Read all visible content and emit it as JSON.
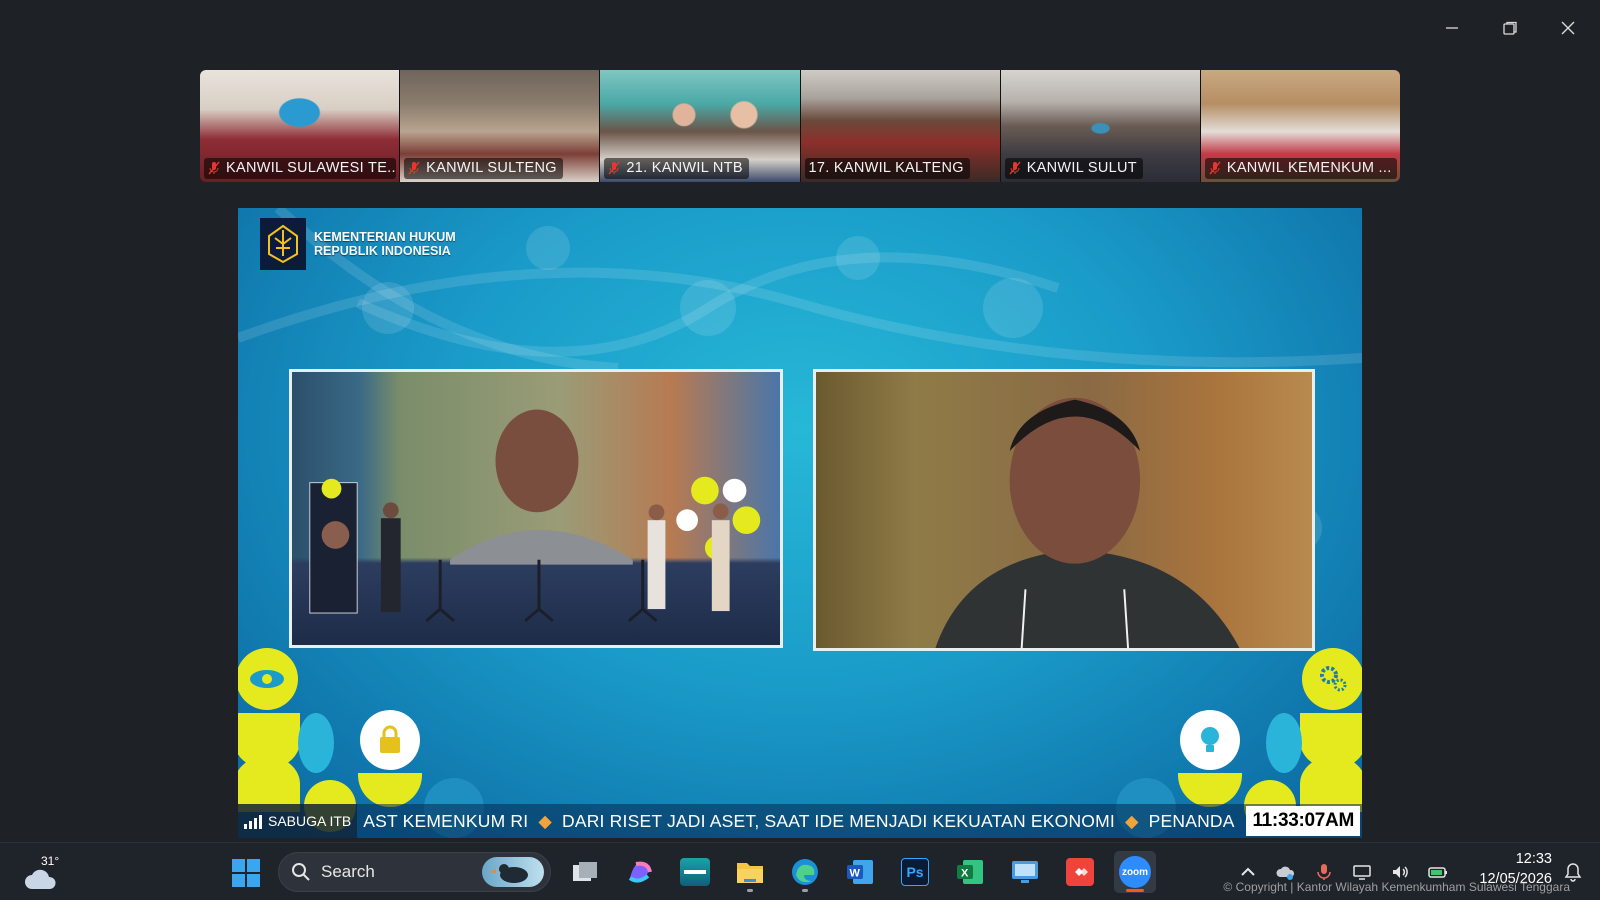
{
  "window": {
    "minimize_icon": "minimize-icon",
    "restore_icon": "restore-icon",
    "close_icon": "close-icon"
  },
  "gallery": {
    "participants": [
      {
        "name": "KANWIL SULAWESI TE...",
        "muted": true
      },
      {
        "name": "KANWIL SULTENG",
        "muted": true
      },
      {
        "name": "21. KANWIL NTB",
        "muted": true
      },
      {
        "name": "17. KANWIL KALTENG",
        "muted": false
      },
      {
        "name": "KANWIL SULUT",
        "muted": true
      },
      {
        "name": "KANWIL KEMENKUM ...",
        "muted": true
      }
    ]
  },
  "share": {
    "brand_line1": "KEMENTERIAN HUKUM",
    "brand_line2": "REPUBLIK INDONESIA",
    "ticker_source": "SABUGA ITB",
    "ticker_items": [
      "AST KEMENKUM RI",
      "DARI RISET JADI ASET, SAAT IDE MENJADI KEKUATAN EKONOMI",
      "PENANDA"
    ],
    "clock": "11:33:07AM"
  },
  "taskbar": {
    "weather_temp": "31°",
    "search_placeholder": "Search",
    "apps": [
      "task-view",
      "copilot",
      "news-app",
      "file-explorer",
      "edge",
      "word",
      "photoshop",
      "excel",
      "remote-desktop",
      "anydesk",
      "zoom"
    ],
    "active_app": "zoom",
    "time": "12:33",
    "date": "12/05/2026",
    "copyright": "© Copyright | Kantor Wilayah Kemenkumham Sulawesi Tenggara"
  },
  "colors": {
    "stage_accent": "#1a9bc9",
    "deco_yellow": "#e4ea1e",
    "ticker_diamond": "#f2a33a",
    "zoom_blue": "#2d8cff"
  }
}
